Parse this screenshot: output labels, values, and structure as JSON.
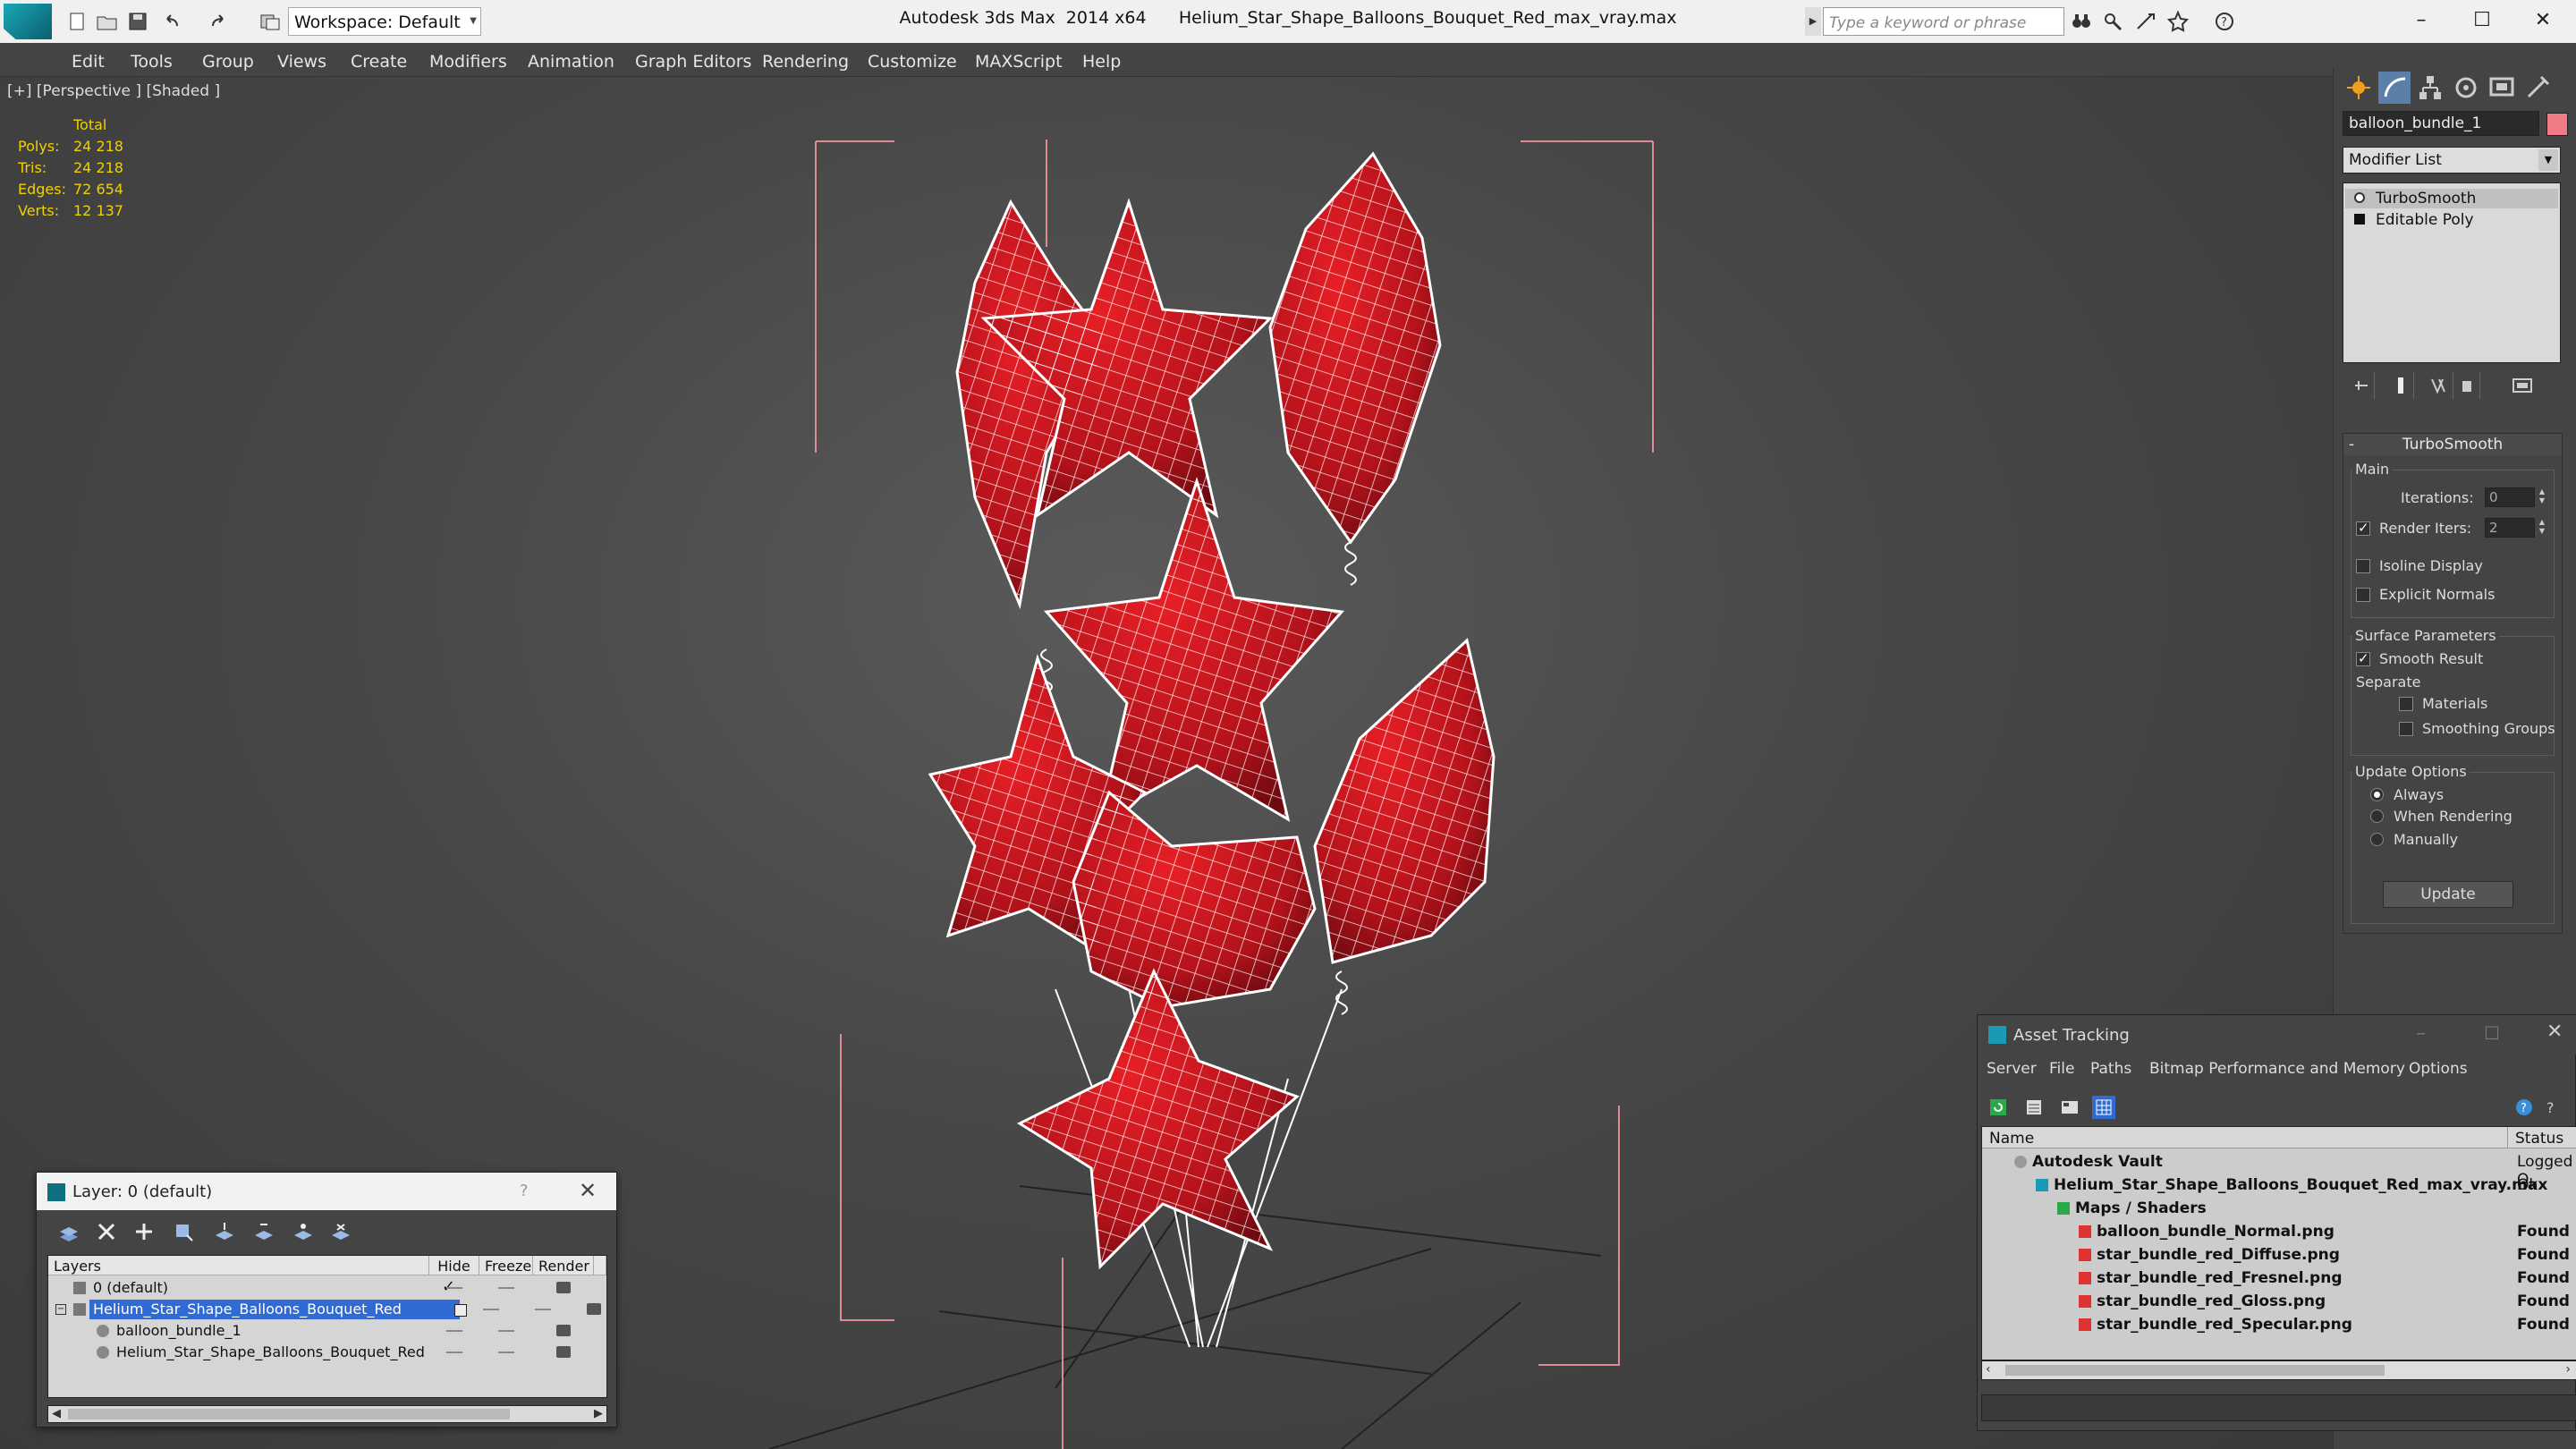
{
  "titlebar": {
    "workspace": "Workspace: Default",
    "app_title": "Autodesk 3ds Max  2014 x64",
    "file_title": "Helium_Star_Shape_Balloons_Bouquet_Red_max_vray.max",
    "search_placeholder": "Type a keyword or phrase"
  },
  "menu": [
    "Edit",
    "Tools",
    "Group",
    "Views",
    "Create",
    "Modifiers",
    "Animation",
    "Graph Editors",
    "Rendering",
    "Customize",
    "MAXScript",
    "Help"
  ],
  "viewport": {
    "label": "[+] [Perspective ] [Shaded ]",
    "stats_header": "Total",
    "stats": [
      {
        "label": "Polys:",
        "value": "24 218"
      },
      {
        "label": "Tris:",
        "value": "24 218"
      },
      {
        "label": "Edges:",
        "value": "72 654"
      },
      {
        "label": "Verts:",
        "value": "12 137"
      }
    ],
    "object_color": "#c8141e",
    "wire_color": "#ffffff",
    "bbox_color": "#e08a96"
  },
  "command_panel": {
    "object_name": "balloon_bundle_1",
    "modifier_list": "Modifier List",
    "stack": [
      "TurboSmooth",
      "Editable Poly"
    ],
    "rollout": {
      "title": "TurboSmooth",
      "main_group": "Main",
      "iterations_label": "Iterations:",
      "iterations_value": "0",
      "render_iters_label": "Render Iters:",
      "render_iters_value": "2",
      "render_iters_checked": true,
      "isoline_label": "Isoline Display",
      "explicit_normals_label": "Explicit Normals",
      "surface_group": "Surface Parameters",
      "smooth_result_label": "Smooth Result",
      "separate_label": "Separate",
      "materials_label": "Materials",
      "smoothing_groups_label": "Smoothing Groups",
      "update_group": "Update Options",
      "always_label": "Always",
      "when_rendering_label": "When Rendering",
      "manually_label": "Manually",
      "update_button": "Update"
    }
  },
  "layer_window": {
    "title": "Layer: 0 (default)",
    "help": "?",
    "columns": [
      "Layers",
      "Hide",
      "Freeze",
      "Render"
    ],
    "rows": [
      {
        "name": "0 (default)",
        "indent": 0,
        "selected": false
      },
      {
        "name": "Helium_Star_Shape_Balloons_Bouquet_Red",
        "indent": 0,
        "selected": true
      },
      {
        "name": "balloon_bundle_1",
        "indent": 1,
        "selected": false
      },
      {
        "name": "Helium_Star_Shape_Balloons_Bouquet_Red",
        "indent": 1,
        "selected": false
      }
    ]
  },
  "asset_window": {
    "title": "Asset Tracking",
    "menu": [
      "Server",
      "File",
      "Paths",
      "Bitmap Performance and Memory",
      "Options"
    ],
    "columns": [
      "Name",
      "Status"
    ],
    "rows": [
      {
        "name": "Autodesk Vault",
        "status": "Logged O",
        "indent": 0
      },
      {
        "name": "Helium_Star_Shape_Balloons_Bouquet_Red_max_vray.max",
        "status": "Ok",
        "indent": 1
      },
      {
        "name": "Maps / Shaders",
        "status": "",
        "indent": 2
      },
      {
        "name": "balloon_bundle_Normal.png",
        "status": "Found",
        "indent": 3
      },
      {
        "name": "star_bundle_red_Diffuse.png",
        "status": "Found",
        "indent": 3
      },
      {
        "name": "star_bundle_red_Fresnel.png",
        "status": "Found",
        "indent": 3
      },
      {
        "name": "star_bundle_red_Gloss.png",
        "status": "Found",
        "indent": 3
      },
      {
        "name": "star_bundle_red_Specular.png",
        "status": "Found",
        "indent": 3
      }
    ]
  }
}
